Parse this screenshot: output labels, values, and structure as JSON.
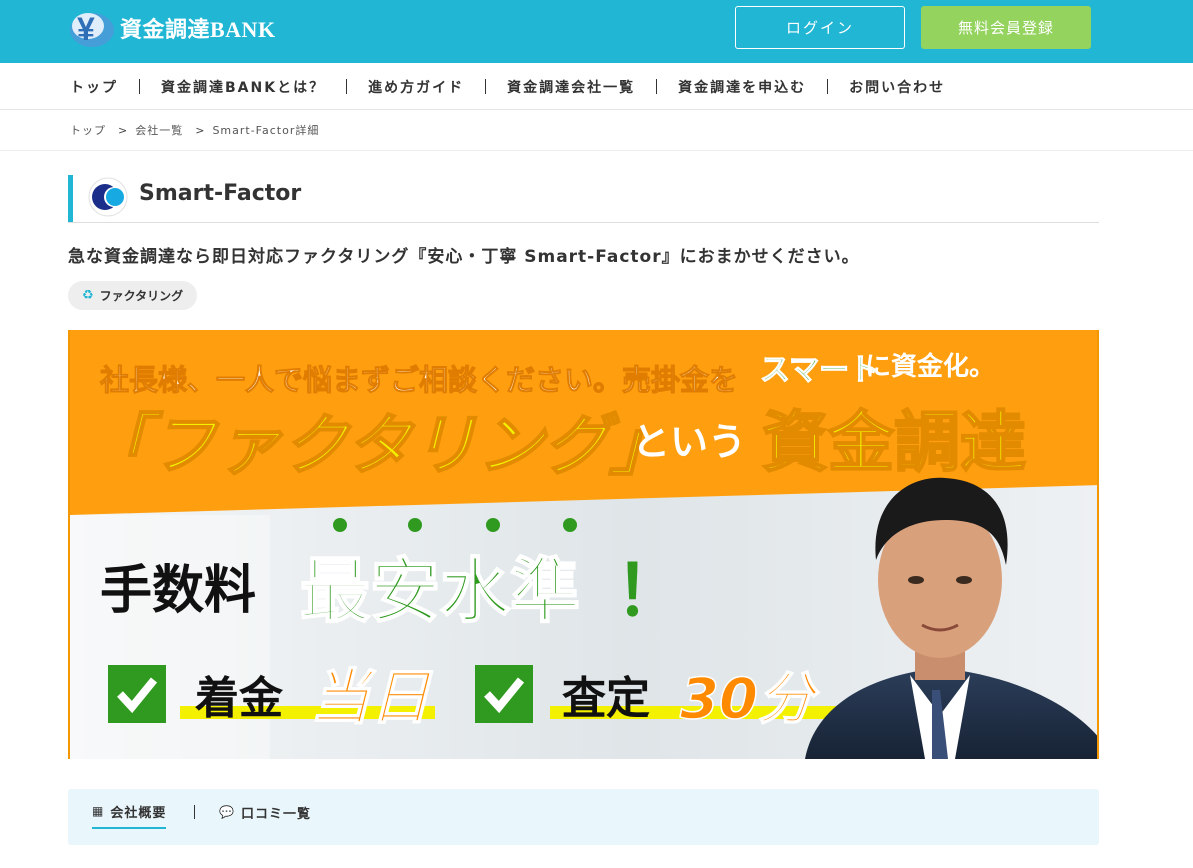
{
  "header": {
    "logo_text": "資金調達BANK",
    "login_label": "ログイン",
    "register_label": "無料会員登録",
    "colors": {
      "bar": "#20b6d4",
      "register_button": "#93d35e"
    }
  },
  "nav": {
    "items": [
      {
        "label": "トップ"
      },
      {
        "label": "資金調達BANKとは？"
      },
      {
        "label": "進め方ガイド"
      },
      {
        "label": "資金調達会社一覧"
      },
      {
        "label": "資金調達を申込む"
      },
      {
        "label": "お問い合わせ"
      }
    ]
  },
  "breadcrumb": {
    "items": [
      "トップ",
      "会社一覧",
      "Smart-Factor詳細"
    ],
    "separator_icon": "chevron-right-icon"
  },
  "company": {
    "name": "Smart-Factor",
    "tagline": "急な資金調達なら即日対応ファクタリング『安心・丁寧 Smart-Factor』におまかせください。",
    "tag": {
      "label": "ファクタリング",
      "icon": "recycle-icon"
    }
  },
  "banner": {
    "line1_a": "社長様、一人で悩まずご相談ください。売掛金を",
    "line1_smart": "スマート",
    "line1_b": "に資金化。",
    "factoring": "「ファクタリング」",
    "toiu": "という",
    "shikin": "資金調達",
    "fee_label": "手数料",
    "fee_value": "最安水準",
    "fee_mark": "！",
    "check1_label": "着金",
    "check1_value": "当日",
    "check2_label": "査定",
    "check2_value": "30分",
    "check_icon": "checkmark-icon",
    "colors": {
      "orange": "#ff9f0f",
      "yellow": "#f4f100",
      "green": "#2f9a1f",
      "value_orange": "#ff8a00"
    }
  },
  "tabs": {
    "overview_label": "会社概要",
    "overview_icon": "building-icon",
    "reviews_label": "口コミ一覧",
    "reviews_icon": "speech-bubbles-icon"
  }
}
